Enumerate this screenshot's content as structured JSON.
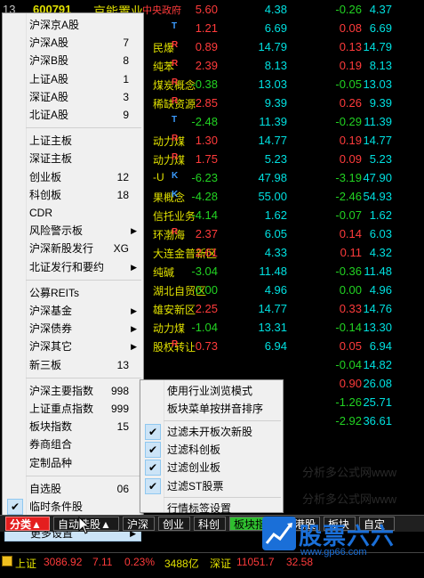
{
  "table": {
    "first_row": {
      "num": "13",
      "code": "600791",
      "name": "京能置业",
      "tag": "中央政府"
    },
    "rows": [
      {
        "name2": "",
        "flag": "T",
        "flag_color": "#3b9bff",
        "pct": "1.21",
        "pct_dir": "up",
        "price": "6.69",
        "chg": "0.08",
        "chg_dir": "up",
        "last": "6.69",
        "last_dir": "up"
      },
      {
        "name2": "民爆",
        "flag": "R",
        "flag_color": "#ff3b3b",
        "pct": "0.89",
        "pct_dir": "up",
        "price": "14.79",
        "chg": "0.13",
        "chg_dir": "up",
        "last": "14.79",
        "last_dir": "up"
      },
      {
        "name2": "纯苯",
        "flag": "R",
        "flag_color": "#ff3b3b",
        "pct": "2.39",
        "pct_dir": "up",
        "price": "8.13",
        "chg": "0.19",
        "chg_dir": "up",
        "last": "8.13",
        "last_dir": "up"
      },
      {
        "name2": "煤炭概念",
        "flag": "R",
        "flag_color": "#ff3b3b",
        "pct": "-0.38",
        "pct_dir": "dn",
        "price": "13.03",
        "chg": "-0.05",
        "chg_dir": "dn",
        "last": "13.03",
        "last_dir": "dn"
      },
      {
        "name2": "稀缺资源",
        "flag": "R",
        "flag_color": "#ff3b3b",
        "pct": "2.85",
        "pct_dir": "up",
        "price": "9.39",
        "chg": "0.26",
        "chg_dir": "up",
        "last": "9.39",
        "last_dir": "up"
      },
      {
        "name2": "",
        "flag": "T",
        "flag_color": "#3b9bff",
        "pct": "-2.48",
        "pct_dir": "dn",
        "price": "11.39",
        "chg": "-0.29",
        "chg_dir": "dn",
        "last": "11.39",
        "last_dir": "dn"
      },
      {
        "name2": "动力煤",
        "flag": "R",
        "flag_color": "#ff3b3b",
        "pct": "1.30",
        "pct_dir": "up",
        "price": "14.77",
        "chg": "0.19",
        "chg_dir": "up",
        "last": "14.77",
        "last_dir": "up"
      },
      {
        "name2": "动力煤",
        "flag": "R",
        "flag_color": "#ff3b3b",
        "pct": "1.75",
        "pct_dir": "up",
        "price": "5.23",
        "chg": "0.09",
        "chg_dir": "up",
        "last": "5.23",
        "last_dir": "up"
      },
      {
        "name2": "-U",
        "flag": "K",
        "flag_color": "#3b9bff",
        "pct": "-6.23",
        "pct_dir": "dn",
        "price": "47.98",
        "chg": "-3.19",
        "chg_dir": "dn",
        "last": "47.90",
        "last_dir": "dn"
      },
      {
        "name2": "果概念",
        "flag": "K",
        "flag_color": "#3b9bff",
        "pct": "-4.28",
        "pct_dir": "dn",
        "price": "55.00",
        "chg": "-2.46",
        "chg_dir": "dn",
        "last": "54.93",
        "last_dir": "dn"
      },
      {
        "name2": "信托业务",
        "flag": "",
        "flag_color": "#3b9bff",
        "pct": "-4.14",
        "pct_dir": "dn",
        "price": "1.62",
        "chg": "-0.07",
        "chg_dir": "dn",
        "last": "1.62",
        "last_dir": "dn"
      },
      {
        "name2": "环渤海",
        "flag": "R",
        "flag_color": "#ff3b3b",
        "pct": "2.37",
        "pct_dir": "up",
        "price": "6.05",
        "chg": "0.14",
        "chg_dir": "up",
        "last": "6.03",
        "last_dir": "up"
      },
      {
        "name2": "大连金普新区",
        "flag": "",
        "flag_color": "#3b9bff",
        "pct": "2.61",
        "pct_dir": "up",
        "price": "4.33",
        "chg": "0.11",
        "chg_dir": "up",
        "last": "4.32",
        "last_dir": "up"
      },
      {
        "name2": "纯碱",
        "flag": "",
        "flag_color": "#3b9bff",
        "pct": "-3.04",
        "pct_dir": "dn",
        "price": "11.48",
        "chg": "-0.36",
        "chg_dir": "dn",
        "last": "11.48",
        "last_dir": "dn"
      },
      {
        "name2": "湖北自贸区",
        "flag": "",
        "flag_color": "#3b9bff",
        "pct": "0.00",
        "pct_dir": "dn",
        "price": "4.96",
        "chg": "0.00",
        "chg_dir": "dn",
        "last": "4.96",
        "last_dir": "dn"
      },
      {
        "name2": "雄安新区",
        "flag": "",
        "flag_color": "#3b9bff",
        "pct": "2.25",
        "pct_dir": "up",
        "price": "14.77",
        "chg": "0.33",
        "chg_dir": "up",
        "last": "14.76",
        "last_dir": "up"
      },
      {
        "name2": "动力煤",
        "flag": "",
        "flag_color": "#3b9bff",
        "pct": "-1.04",
        "pct_dir": "dn",
        "price": "13.31",
        "chg": "-0.14",
        "chg_dir": "dn",
        "last": "13.30",
        "last_dir": "dn"
      },
      {
        "name2": "股权转让",
        "flag": "R",
        "flag_color": "#ff3b3b",
        "pct": "0.73",
        "pct_dir": "up",
        "price": "6.94",
        "chg": "0.05",
        "chg_dir": "up",
        "last": "6.94",
        "last_dir": "up"
      },
      {
        "name2": "",
        "flag": "",
        "flag_color": "#3b9bff",
        "pct": "",
        "pct_dir": "dn",
        "price": "",
        "chg": "-0.04",
        "chg_dir": "dn",
        "last": "14.82",
        "last_dir": "dn"
      },
      {
        "name2": "",
        "flag": "",
        "flag_color": "#3b9bff",
        "pct": "",
        "pct_dir": "up",
        "price": "",
        "chg": "0.90",
        "chg_dir": "up",
        "last": "26.08",
        "last_dir": "up"
      },
      {
        "name2": "",
        "flag": "",
        "flag_color": "#3b9bff",
        "pct": "",
        "pct_dir": "dn",
        "price": "",
        "chg": "-1.26",
        "chg_dir": "dn",
        "last": "25.71",
        "last_dir": "dn"
      },
      {
        "name2": "",
        "flag": "",
        "flag_color": "#3b9bff",
        "pct": "",
        "pct_dir": "dn",
        "price": "",
        "chg": "-2.92",
        "chg_dir": "dn",
        "last": "36.61",
        "last_dir": "dn"
      }
    ],
    "first_row_values": {
      "pct": "5.60",
      "price": "4.38",
      "chg": "-0.26",
      "last": "4.37"
    }
  },
  "main_menu": {
    "items": [
      {
        "label": "沪深京A股",
        "shortcut": "",
        "arrow": false,
        "check": false
      },
      {
        "label": "沪深A股",
        "shortcut": "7",
        "arrow": false,
        "check": false
      },
      {
        "label": "沪深B股",
        "shortcut": "8",
        "arrow": false,
        "check": false
      },
      {
        "label": "上证A股",
        "shortcut": "1",
        "arrow": false,
        "check": false
      },
      {
        "label": "深证A股",
        "shortcut": "3",
        "arrow": false,
        "check": false
      },
      {
        "label": "北证A股",
        "shortcut": "9",
        "arrow": false,
        "check": false
      },
      {
        "sep": true
      },
      {
        "label": "上证主板",
        "shortcut": "",
        "arrow": false,
        "check": false
      },
      {
        "label": "深证主板",
        "shortcut": "",
        "arrow": false,
        "check": false
      },
      {
        "label": "创业板",
        "shortcut": "12",
        "arrow": false,
        "check": false
      },
      {
        "label": "科创板",
        "shortcut": "18",
        "arrow": false,
        "check": false
      },
      {
        "label": "CDR",
        "shortcut": "",
        "arrow": false,
        "check": false
      },
      {
        "label": "风险警示板",
        "shortcut": "",
        "arrow": true,
        "check": false
      },
      {
        "label": "沪深新股发行",
        "shortcut": "XG",
        "arrow": false,
        "check": false
      },
      {
        "label": "北证发行和要约",
        "shortcut": "",
        "arrow": true,
        "check": false
      },
      {
        "sep": true
      },
      {
        "label": "公募REITs",
        "shortcut": "",
        "arrow": false,
        "check": false
      },
      {
        "label": "沪深基金",
        "shortcut": "",
        "arrow": true,
        "check": false
      },
      {
        "label": "沪深债券",
        "shortcut": "",
        "arrow": true,
        "check": false
      },
      {
        "label": "沪深其它",
        "shortcut": "",
        "arrow": true,
        "check": false
      },
      {
        "label": "新三板",
        "shortcut": "13",
        "arrow": false,
        "check": false
      },
      {
        "sep": true
      },
      {
        "label": "沪深主要指数",
        "shortcut": "998",
        "arrow": false,
        "check": false
      },
      {
        "label": "上证重点指数",
        "shortcut": "999",
        "arrow": false,
        "check": false
      },
      {
        "label": "板块指数",
        "shortcut": "15",
        "arrow": false,
        "check": false
      },
      {
        "label": "券商组合",
        "shortcut": "",
        "arrow": false,
        "check": false
      },
      {
        "label": "定制品种",
        "shortcut": "",
        "arrow": false,
        "check": false
      },
      {
        "sep": true
      },
      {
        "label": "自选股",
        "shortcut": "06",
        "arrow": false,
        "check": false
      },
      {
        "label": "临时条件股",
        "shortcut": "",
        "arrow": false,
        "check": true
      },
      {
        "sep": true
      },
      {
        "label": "更多设置",
        "shortcut": "",
        "arrow": true,
        "check": false,
        "highlight": true
      }
    ]
  },
  "sub_menu": {
    "items": [
      {
        "label": "使用行业浏览模式",
        "check": false
      },
      {
        "label": "板块菜单按拼音排序",
        "check": false
      },
      {
        "sep": true
      },
      {
        "label": "过滤未开板次新股",
        "check": true
      },
      {
        "label": "过滤科创板",
        "check": true
      },
      {
        "label": "过滤创业板",
        "check": true
      },
      {
        "label": "过滤ST股票",
        "check": true
      },
      {
        "sep": true
      },
      {
        "label": "行情标签设置",
        "check": false
      }
    ]
  },
  "tabs": [
    {
      "label": "分类▲",
      "style": "red"
    },
    {
      "label": "自动选股▲",
      "style": ""
    },
    {
      "label": "沪深",
      "style": ""
    },
    {
      "label": "创业",
      "style": ""
    },
    {
      "label": "科创",
      "style": ""
    },
    {
      "label": "板块指数",
      "style": "green"
    },
    {
      "label": "港股",
      "style": ""
    },
    {
      "label": "板块",
      "style": ""
    },
    {
      "label": "自定",
      "style": ""
    }
  ],
  "status": {
    "sh_label": "上证",
    "sh_value": "3086.92",
    "sh_change": "7.11",
    "sh_pct": "0.23%",
    "sh_volume": "3488亿",
    "sz_label": "深证",
    "sz_value": "11051.7",
    "sz_change": "32.58"
  },
  "watermark": {
    "logo_text": "股票六六",
    "logo_sub": "专注股票的股票学习网站",
    "url": "www.gp66.com",
    "bg_text": "分析多公式网www"
  },
  "colors": {
    "up": "#ff3b3b",
    "down": "#22d322",
    "price": "#00e0e0",
    "menu_bg": "#f0f0f0",
    "highlight": "#cce4f7"
  }
}
